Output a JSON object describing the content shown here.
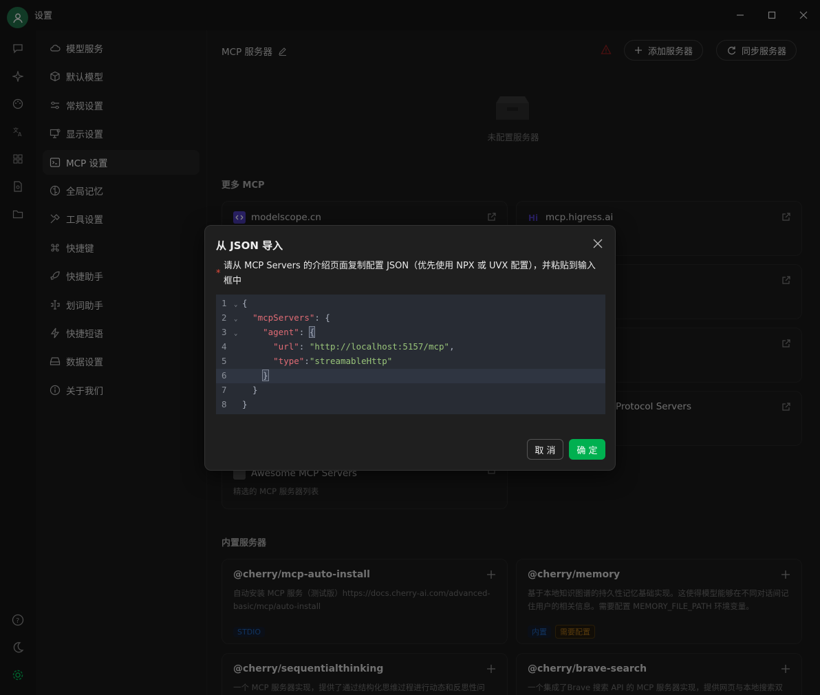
{
  "window": {
    "title": "设置"
  },
  "nav": {
    "items": [
      {
        "label": "模型服务",
        "icon": "cloud-icon"
      },
      {
        "label": "默认模型",
        "icon": "cube-icon"
      },
      {
        "label": "常规设置",
        "icon": "sliders-icon"
      },
      {
        "label": "显示设置",
        "icon": "monitor-icon"
      },
      {
        "label": "MCP 设置",
        "icon": "terminal-icon",
        "active": true
      },
      {
        "label": "全局记忆",
        "icon": "brain-icon"
      },
      {
        "label": "工具设置",
        "icon": "tools-icon"
      },
      {
        "label": "快捷键",
        "icon": "command-icon"
      },
      {
        "label": "快捷助手",
        "icon": "rocket-icon"
      },
      {
        "label": "划词助手",
        "icon": "text-cursor-icon"
      },
      {
        "label": "快捷短语",
        "icon": "zap-icon"
      },
      {
        "label": "数据设置",
        "icon": "hard-drive-icon"
      },
      {
        "label": "关于我们",
        "icon": "info-icon"
      }
    ]
  },
  "header": {
    "title": "MCP 服务器",
    "add_label": "添加服务器",
    "sync_label": "同步服务器"
  },
  "empty": {
    "text": "未配置服务器"
  },
  "more": {
    "title": "更多 MCP",
    "cards": [
      {
        "title": "modelscope.cn"
      },
      {
        "title": "mcp.higress.ai"
      },
      {
        "title": "Protocol Servers"
      },
      {
        "title": "Awesome MCP Servers",
        "desc": "精选的 MCP 服务器列表"
      }
    ]
  },
  "builtin": {
    "title": "内置服务器",
    "cards": [
      {
        "title": "@cherry/mcp-auto-install",
        "desc": "自动安装 MCP 服务（测试版）https://docs.cherry-ai.com/advanced-basic/mcp/auto-install",
        "tags": [
          "STDIO"
        ]
      },
      {
        "title": "@cherry/memory",
        "desc": "基于本地知识图谱的持久性记忆基础实现。这使得模型能够在不同对话间记住用户的相关信息。需要配置 MEMORY_FILE_PATH 环境变量。",
        "tags": [
          "内置",
          "需要配置"
        ]
      },
      {
        "title": "@cherry/sequentialthinking",
        "desc": "一个 MCP 服务器实现，提供了通过结构化思维过程进行动态和反思性问"
      },
      {
        "title": "@cherry/brave-search",
        "desc": "一个集成了Brave 搜索 API 的 MCP 服务器实现，提供网页与本地搜索双"
      }
    ]
  },
  "modal": {
    "title": "从 JSON 导入",
    "required_mark": "*",
    "label": "请从 MCP Servers 的介绍页面复制配置 JSON（优先使用 NPX 或 UVX 配置），并粘贴到输入框中",
    "code_lines": [
      {
        "n": "1",
        "fold": "⌄",
        "text": "{"
      },
      {
        "n": "2",
        "fold": "⌄",
        "text": "  \"mcpServers\": {"
      },
      {
        "n": "3",
        "fold": "⌄",
        "text": "    \"agent\": {"
      },
      {
        "n": "4",
        "fold": "",
        "text": "      \"url\": \"http://localhost:5157/mcp\","
      },
      {
        "n": "5",
        "fold": "",
        "text": "      \"type\":\"streamableHttp\""
      },
      {
        "n": "6",
        "fold": "",
        "text": "    }"
      },
      {
        "n": "7",
        "fold": "",
        "text": "  }"
      },
      {
        "n": "8",
        "fold": "",
        "text": "}"
      }
    ],
    "cancel_label": "取 消",
    "ok_label": "确 定"
  },
  "colors": {
    "accent": "#00b050",
    "background": "#181818",
    "editor_bg": "#282c34",
    "key": "#e06c75",
    "string": "#98c379"
  }
}
